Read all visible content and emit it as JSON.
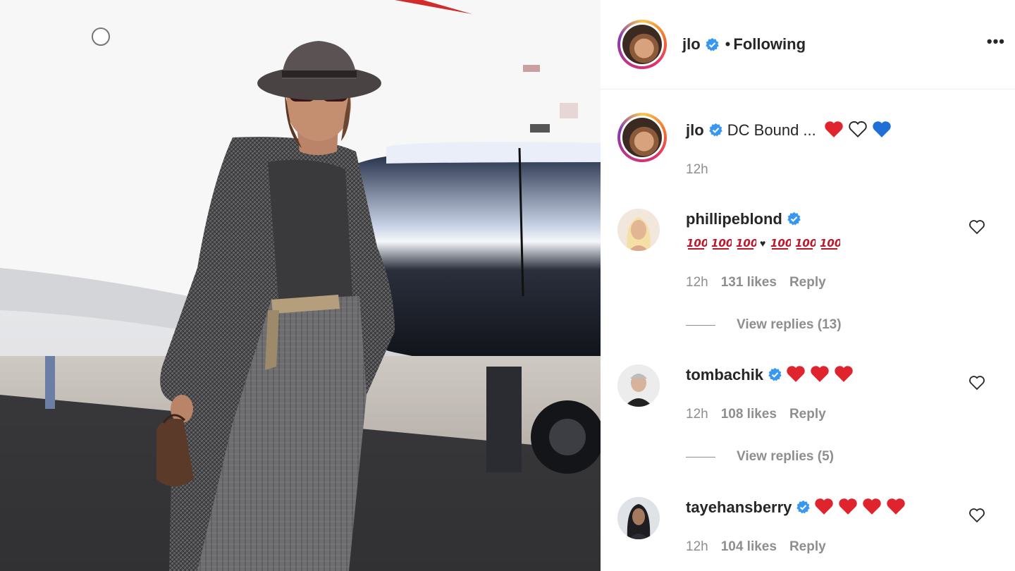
{
  "post": {
    "username": "jlo",
    "follow_sep": "•",
    "follow_status": "Following",
    "more_label": "•••"
  },
  "caption": {
    "username": "jlo",
    "text": "DC Bound ...",
    "time": "12h"
  },
  "comments": [
    {
      "username": "phillipeblond",
      "time": "12h",
      "likes": "131 likes",
      "reply": "Reply",
      "view_replies": "View replies (13)"
    },
    {
      "username": "tombachik",
      "time": "12h",
      "likes": "108 likes",
      "reply": "Reply",
      "view_replies": "View replies (5)"
    },
    {
      "username": "tayehansberry",
      "time": "12h",
      "likes": "104 likes",
      "reply": "Reply"
    }
  ],
  "colors": {
    "verified": "#3897f0",
    "heart_red": "#e0242e",
    "heart_blue": "#1f6fd6",
    "muted": "#8e8e8e"
  },
  "icons": [
    "verified-badge-icon",
    "more-options-icon",
    "like-heart-icon",
    "hundred-points-emoji",
    "red-heart-emoji",
    "white-heart-emoji",
    "blue-heart-emoji"
  ]
}
